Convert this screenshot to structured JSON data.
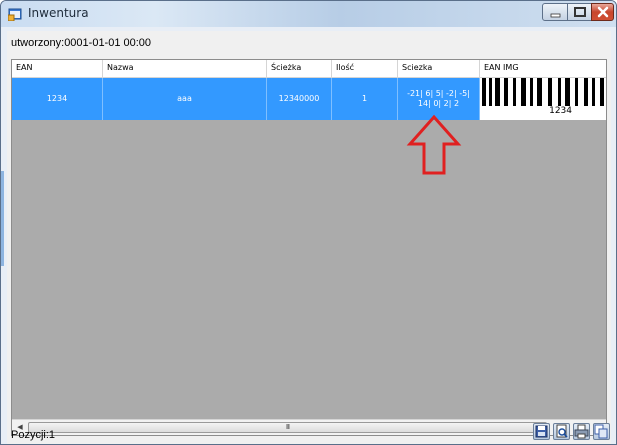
{
  "window": {
    "title": "Inwentura",
    "app_icon": "app-window-icon",
    "controls": [
      "minimize-icon",
      "maximize-icon",
      "close-icon"
    ]
  },
  "created_label": "utworzony:0001-01-01 00:00",
  "grid": {
    "columns": [
      "EAN",
      "Nazwa",
      "Ścieżka",
      "Ilość",
      "Sciezka",
      "EAN IMG"
    ],
    "rows": [
      {
        "ean": "1234",
        "nazwa": "aaa",
        "sciezka": "12340000",
        "ilosc": "1",
        "sciezka2_line1": "-21| 6| 5| -2| -5|",
        "sciezka2_line2": "14| 0| 2| 2",
        "ean_img_text": "1234"
      }
    ],
    "scrollbar_grip": "III"
  },
  "status": {
    "count_label": "Pozycji:1"
  },
  "toolbar_icons": [
    "save-icon",
    "print-preview-icon",
    "print-icon",
    "copy-icon"
  ],
  "colors": {
    "selection": "#3399ff",
    "grid_background": "#ababab",
    "arrow": "#e02020"
  }
}
